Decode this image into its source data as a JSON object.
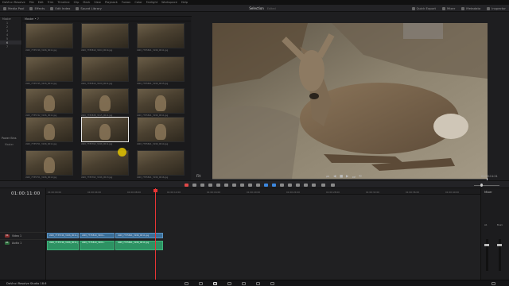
{
  "menubar": {
    "items": [
      "DaVinci Resolve",
      "File",
      "Edit",
      "Trim",
      "Timeline",
      "Clip",
      "Mark",
      "View",
      "Playback",
      "Fusion",
      "Color",
      "Fairlight",
      "Workspace",
      "Help"
    ]
  },
  "toolbar": {
    "media_pool": "Media Pool",
    "effects": "Effects",
    "edit_index": "Edit Index",
    "sound_library": "Sound Library",
    "center_title": "Selection",
    "center_sub": "Edited",
    "sound_export": "Quick Export",
    "mixer": "Mixer",
    "metadata": "Metadata",
    "inspector": "Inspector"
  },
  "subbar": {
    "zoom": "17%",
    "tc_left": "00:00:11:21",
    "tc_mid_a": "01:00:00:00",
    "tc_mid_b": "01:00:11:20",
    "timeline_name": "Timeline 1",
    "tc_right": "01:00:11:00",
    "tc_right_b": "01:00:11:21"
  },
  "bins": {
    "title": "Master",
    "items": [
      "1",
      "2",
      "3",
      "4",
      "5",
      "6",
      "7"
    ],
    "smart_bins": "Power Bins",
    "smart_item": "Master"
  },
  "media_pool": {
    "header": "Master • 7",
    "clips": [
      "AW0_7785746_3196_0011.jpg",
      "AW0_7785810_3204_0014.jpg",
      "AW0_7785841_3196_0011.jpg",
      "AW0_7785745_3226_0011.jpg",
      "AW0_7785810_3229_0011.jpg",
      "AW0_7785841_3196_0015.jpg",
      "AW0_7785742_3196_0011.jpg",
      "AW0_7785838_3215_0011.jpg",
      "AW0_7785841_3196_0011.jpg",
      "AW0_7785751_3196_0011.jpg",
      "AW0_7785762_3196_0011.jpg",
      "AW0_7785841_3196_0014.jpg",
      "AW0_7785751_3196_0012.jpg",
      "AW0_7785762_3196_0013.jpg",
      "AW0_7785841_3196_0016.jpg"
    ]
  },
  "viewer": {
    "zoom": "Fit",
    "timecode": "01:00:11:21",
    "audio_track": "01:00:00:00"
  },
  "timeline": {
    "timecode": "01:00:11:00",
    "ruler": [
      "01:00:00:00",
      "01:00:04:00",
      "01:00:08:00",
      "01:00:12:00",
      "01:00:16:00",
      "01:00:20:00",
      "01:00:24:00",
      "01:00:28:00",
      "01:00:32:00",
      "01:00:36:00",
      "01:00:40:00"
    ],
    "tracks": [
      {
        "tag": "V1",
        "name": "Video 1",
        "type": "video"
      },
      {
        "tag": "A1",
        "name": "Audio 1",
        "type": "audio"
      }
    ],
    "video_clips": [
      "AW0_7735746_3196_0011.jpg",
      "AW0_7735810_3204...",
      "AW0_7735841_3196_0011.jpg"
    ],
    "audio_clips": [
      "AW0_7735746_3196_0011.jpg",
      "AW0_7735810_3204...",
      "AW0_7735841_3196_0011.jpg"
    ]
  },
  "mixer": {
    "title": "Mixer",
    "label_a1": "A1",
    "label_bus": "Bus1",
    "label_main": "M1"
  },
  "footer": {
    "app_name": "DaVinci Resolve Studio 18.6"
  },
  "colors": {
    "video_clip": "#3c6e97",
    "audio_clip": "#2d9263",
    "playhead": "#e83535",
    "cursor": "#e3c400"
  }
}
